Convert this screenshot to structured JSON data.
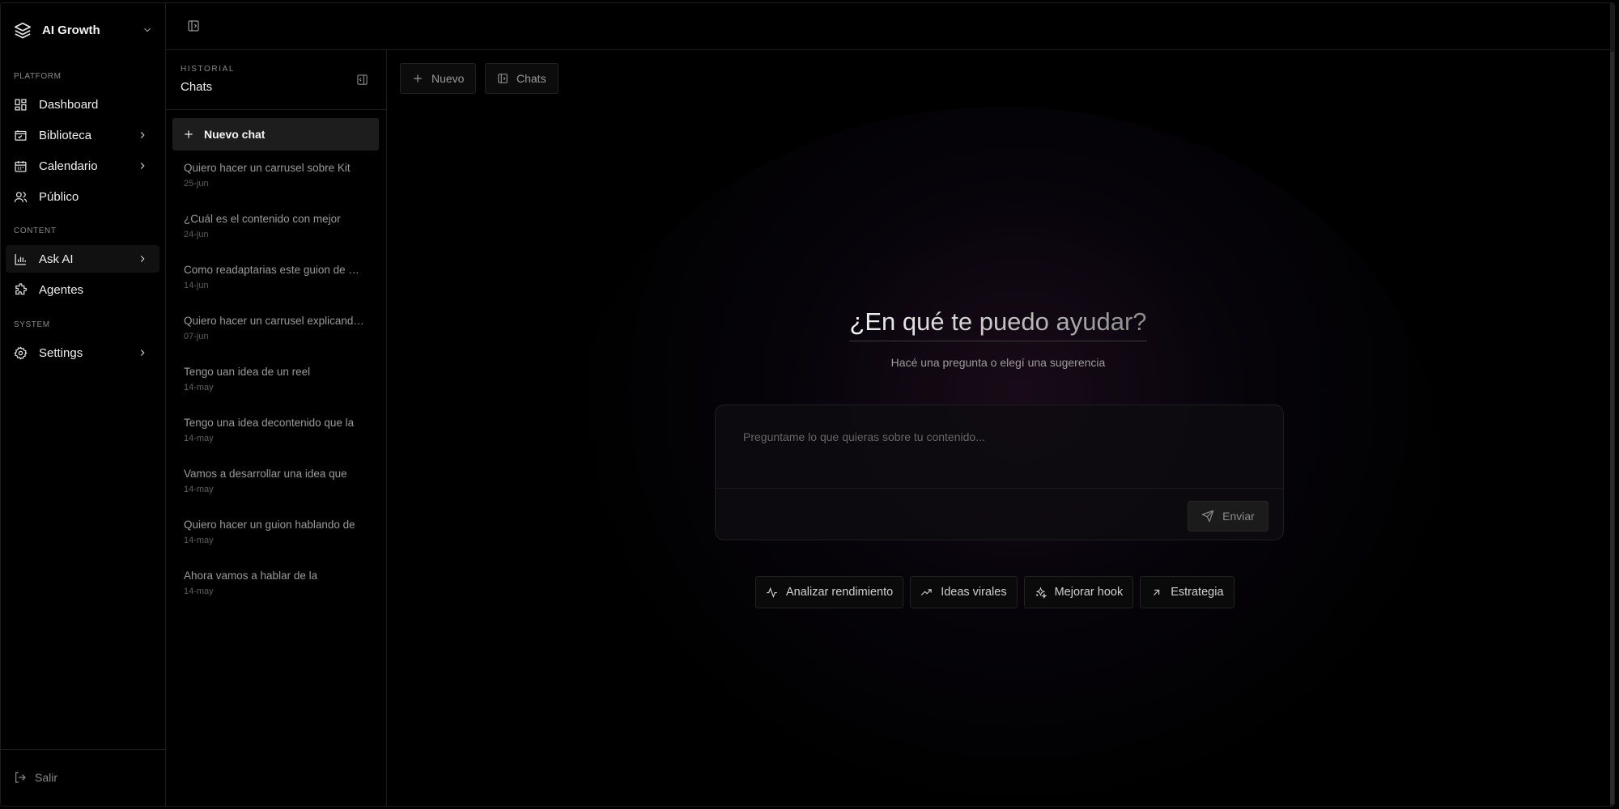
{
  "workspace": {
    "name": "AI Growth"
  },
  "sidebar": {
    "sections": [
      {
        "label": "PLATFORM"
      },
      {
        "label": "CONTENT"
      },
      {
        "label": "SYSTEM"
      }
    ],
    "items": [
      {
        "label": "Dashboard",
        "icon": "dashboard-icon"
      },
      {
        "label": "Biblioteca",
        "icon": "library-icon"
      },
      {
        "label": "Calendario",
        "icon": "calendar-icon"
      },
      {
        "label": "Público",
        "icon": "users-icon"
      },
      {
        "label": "Ask AI",
        "icon": "chart-icon"
      },
      {
        "label": "Agentes",
        "icon": "puzzle-icon"
      },
      {
        "label": "Settings",
        "icon": "gear-icon"
      }
    ],
    "logout_label": "Salir"
  },
  "history": {
    "eyebrow": "HISTORIAL",
    "title": "Chats",
    "new_chat_label": "Nuevo chat",
    "chats": [
      {
        "title": "Quiero hacer un carrusel sobre Kit",
        "date": "25-jun"
      },
      {
        "title": "¿Cuál es el contenido con mejor",
        "date": "24-jun"
      },
      {
        "title": "Como readaptarias este guion de …",
        "date": "14-jun"
      },
      {
        "title": "Quiero hacer un carrusel explicand…",
        "date": "07-jun"
      },
      {
        "title": "Tengo uan idea de un reel",
        "date": "14-may"
      },
      {
        "title": "Tengo una idea decontenido que la",
        "date": "14-may"
      },
      {
        "title": "Vamos a desarrollar una idea que",
        "date": "14-may"
      },
      {
        "title": "Quiero hacer un guion hablando de",
        "date": "14-may"
      },
      {
        "title": "Ahora vamos a hablar de la",
        "date": "14-may"
      }
    ]
  },
  "main": {
    "tabs": [
      {
        "label": "Nuevo",
        "icon": "plus-icon"
      },
      {
        "label": "Chats",
        "icon": "panel-icon"
      }
    ],
    "title": "¿En qué te puedo ayudar?",
    "subtitle": "Hacé una pregunta o elegí una sugerencia",
    "input_placeholder": "Preguntame lo que quieras sobre tu contenido...",
    "send_label": "Enviar",
    "suggestions": [
      {
        "label": "Analizar rendimiento",
        "icon": "activity-icon"
      },
      {
        "label": "Ideas virales",
        "icon": "trending-up-icon"
      },
      {
        "label": "Mejorar hook",
        "icon": "sparkles-icon"
      },
      {
        "label": "Estrategia",
        "icon": "arrow-up-right-icon"
      }
    ]
  },
  "colors": {
    "background": "#000000",
    "border": "#1e1e1e",
    "muted_text": "#8a8a8a"
  }
}
